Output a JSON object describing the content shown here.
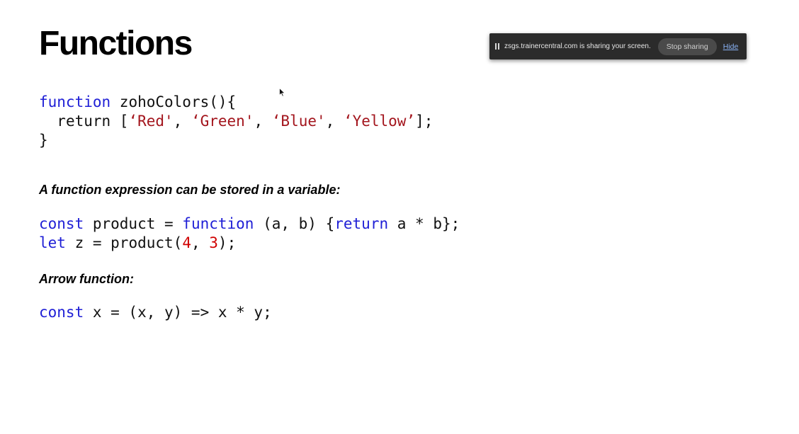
{
  "slide": {
    "title": "Functions",
    "code_block_1": {
      "line1": {
        "kw": "function",
        "rest": " zohoColors(){"
      },
      "line2": {
        "indent": "  ",
        "kw": "return",
        "open": " [",
        "s1": "‘Red'",
        "sep1": ", ",
        "s2": "‘Green'",
        "sep2": ", ",
        "s3": "‘Blue'",
        "sep3": ", ",
        "s4": "‘Yellow’",
        "close": "];"
      },
      "line3": "}"
    },
    "note_expression": "A function expression can be stored in a variable:",
    "code_block_2": {
      "line1": {
        "kw_const": "const",
        "mid": " product = ",
        "kw_function": "function",
        "args": " (a, b) {",
        "kw_return": "return",
        "body": " a * b};"
      },
      "line2": {
        "kw_let": "let",
        "mid": " z = product(",
        "n1": "4",
        "sep": ", ",
        "n2": "3",
        "close": ");"
      }
    },
    "note_arrow": "Arrow function:",
    "code_block_3": {
      "kw_const": "const",
      "rest": " x = (x, y) => x * y;"
    }
  },
  "share_bar": {
    "message": "zsgs.trainercentral.com is sharing your screen.",
    "stop_label": "Stop sharing",
    "hide_label": "Hide"
  },
  "colors": {
    "keyword": "#1f1fd6",
    "string": "#a3151d",
    "number": "#d00000",
    "share_bar_bg": "#2b2b2b",
    "hide_link": "#8ab4f8"
  },
  "icons": {
    "pause": "pause-icon",
    "cursor": "mouse-pointer-icon"
  }
}
